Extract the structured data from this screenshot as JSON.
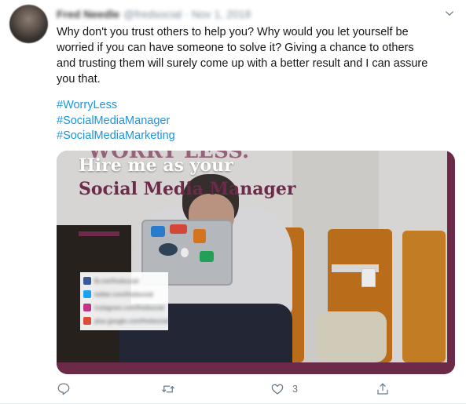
{
  "tweet": {
    "author_name": "Fred Needle",
    "author_handle": "@fredsocial",
    "date": "Nov 1, 2018",
    "text": "Why don't you trust others to help you? Why would you let yourself be worried if you can have someone to solve it? Giving a chance to others and trusting them will surely come up with a better result and I can assure you that.",
    "hashtags": [
      "#WorryLess",
      "#SocialMediaManager",
      "#SocialMediaMarketing"
    ]
  },
  "media": {
    "ghost_text": "WORRY LESS.",
    "headline_line1": "Hire me as your",
    "headline_line2": "Social Media Manager",
    "social_links": [
      {
        "network": "facebook",
        "icon": "facebook-icon",
        "handle": "fb.me/fredsocial",
        "color": "#3b5998"
      },
      {
        "network": "twitter",
        "icon": "twitter-icon",
        "handle": "twitter.com/fredsocial",
        "color": "#1da1f2"
      },
      {
        "network": "instagram",
        "icon": "instagram-icon",
        "handle": "instagram.com/fredsocial",
        "color": "#c13584"
      },
      {
        "network": "google-plus",
        "icon": "google-plus-icon",
        "handle": "plus.google.com/fredsocial",
        "color": "#dd4b39"
      }
    ],
    "accent_color": "#6d2a4a"
  },
  "actions": {
    "reply_icon": "reply-icon",
    "retweet_icon": "retweet-icon",
    "like_icon": "heart-icon",
    "like_count": "3",
    "share_icon": "share-icon"
  },
  "colors": {
    "link": "#1b95e0",
    "secondary_text": "#657786"
  }
}
